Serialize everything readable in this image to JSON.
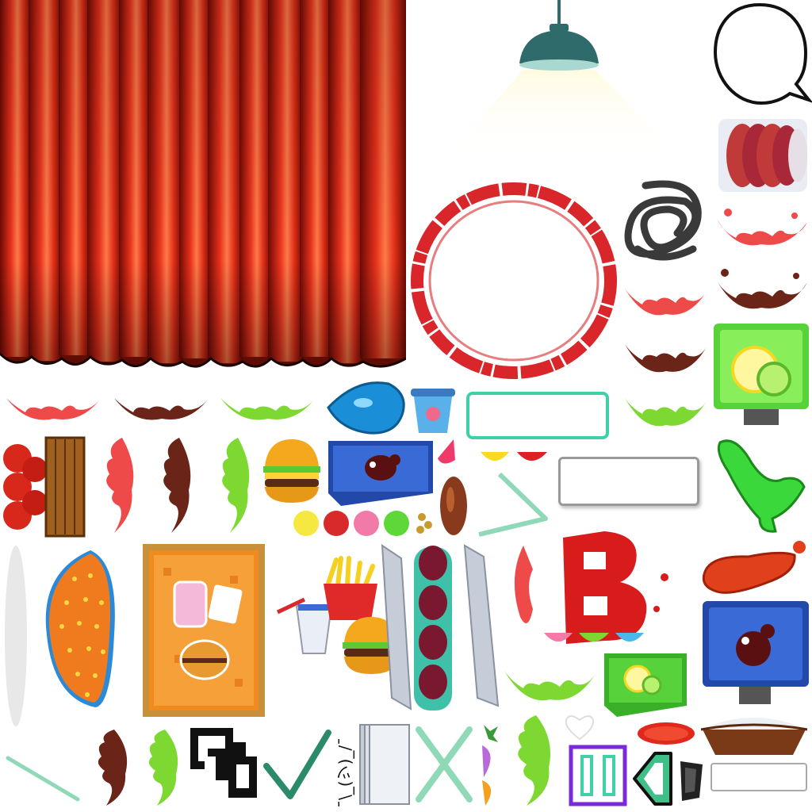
{
  "sheet": {
    "shrug_text": "¯\\_(ツ)_/¯"
  },
  "colors": {
    "curtain": "#e8321c",
    "curtain_dark": "#7a0d06",
    "stamp_red": "#d8262a",
    "ketchup": "#ef4a4a",
    "sauce_brown": "#6b2418",
    "lime_green": "#7ed832",
    "panel_teal": "#3fd0a8",
    "lamp": "#2f6b6b",
    "box_blue": "#3a6ad6",
    "box_green": "#58d23a",
    "tray_orange": "#f08a1e"
  },
  "sprites": [
    "curtain",
    "ceiling-lamp",
    "speech-bubble",
    "meat-patties-stack",
    "red-ring-stamp",
    "scribble",
    "splash-red",
    "splash-brown",
    "splash-green",
    "lime-box",
    "water-drop",
    "ice-cream-cup",
    "teal-panel",
    "tomato-crate",
    "burger",
    "sauce-box-blue",
    "color-dots",
    "sausage",
    "triangle-frame",
    "white-panel",
    "green-tube",
    "taco-shell",
    "menu-poster",
    "fries-drink-burger",
    "sausage-skewer",
    "letter-b",
    "orange-drop",
    "cola-box",
    "lime-box-small",
    "tomato-slice",
    "pie",
    "checkmark",
    "cross-mark",
    "paper-stack",
    "bracket-pixel",
    "purple-frame",
    "arrow-shape"
  ]
}
